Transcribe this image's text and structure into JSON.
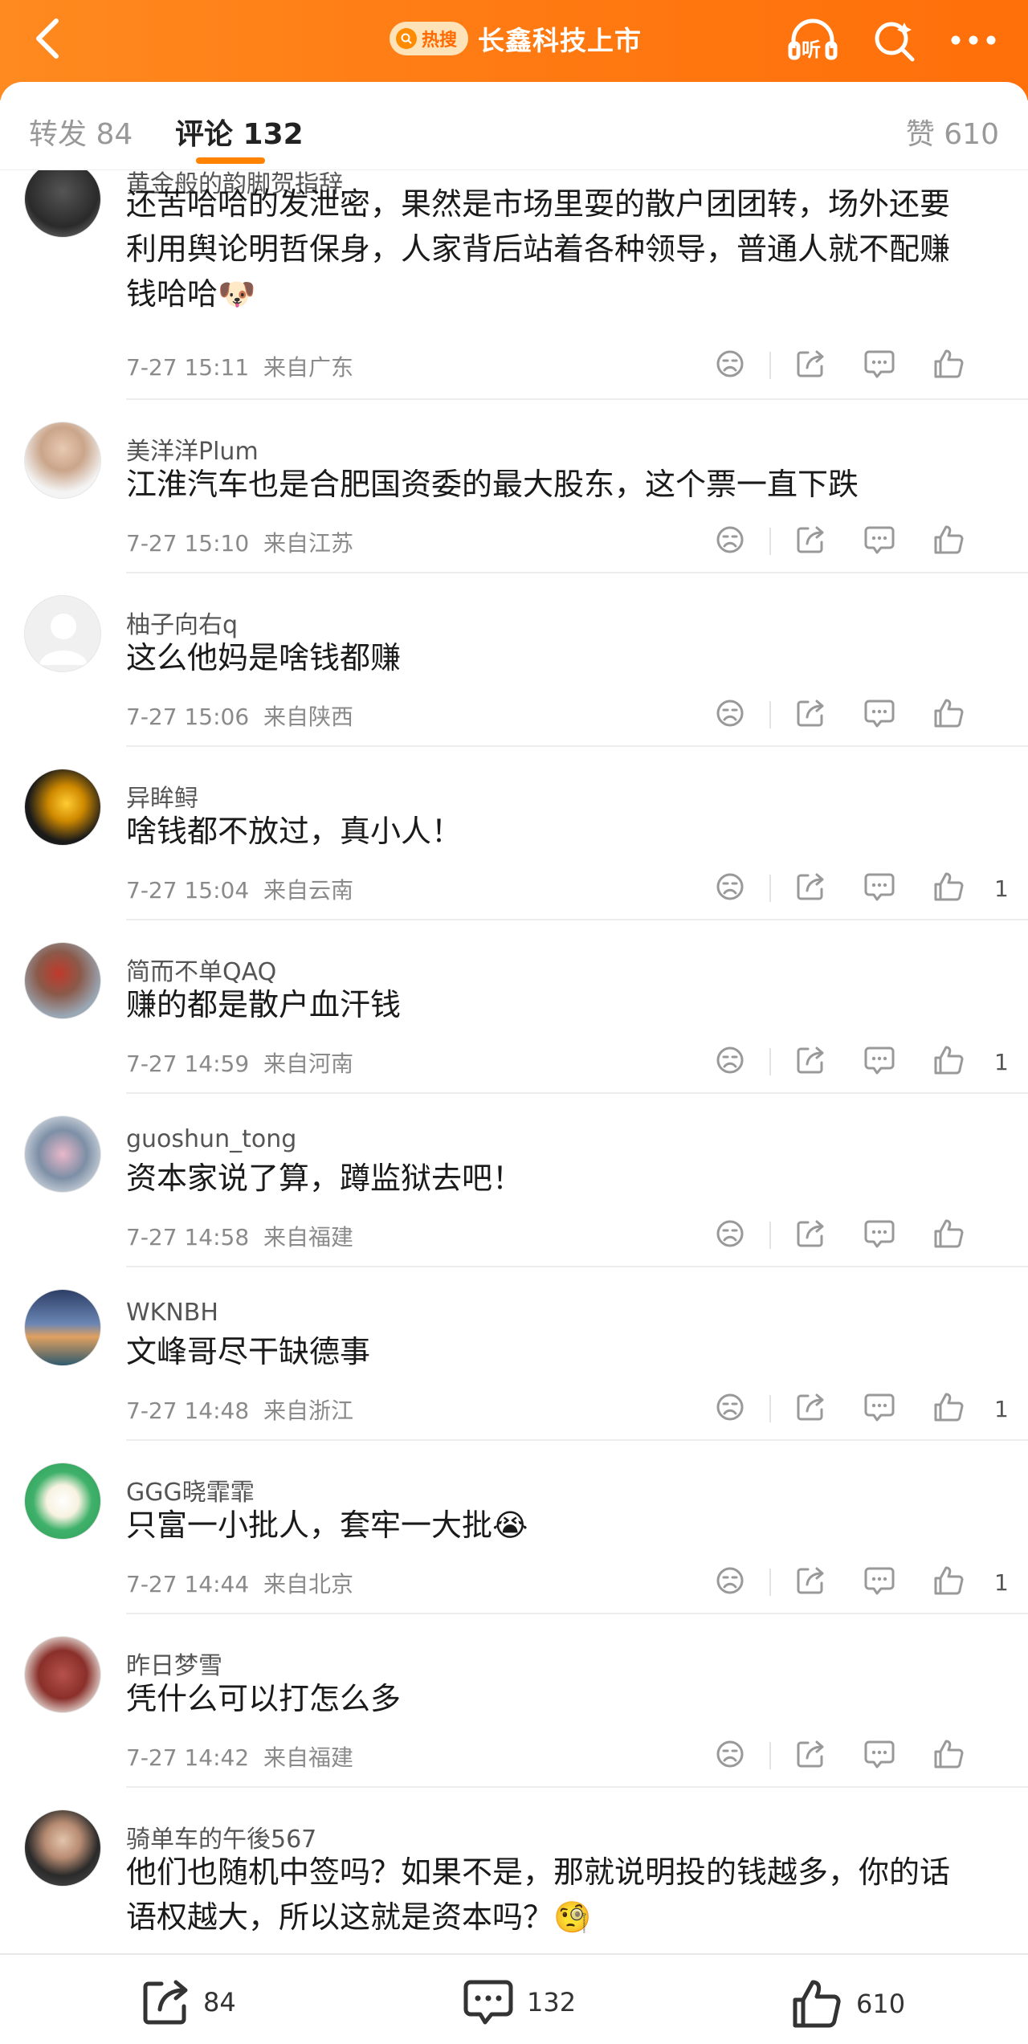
{
  "header": {
    "hot_badge": "热搜",
    "title": "长鑫科技上市",
    "listen_label": "听",
    "icons": [
      "back-icon",
      "listen-icon",
      "search-icon",
      "more-icon"
    ],
    "accent_color": "#ff7a12"
  },
  "tabs": {
    "repost": "转发 84",
    "comments": "评论 132",
    "likes": "赞 610"
  },
  "comments": [
    {
      "user": "黄金般的韵脚贺指辞",
      "text_lines": [
        "还苦哈哈的发泄密，果然是市场里耍的散户团团转，场外还要",
        "利用舆论明哲保身，人家背后站着各种领导，普通人就不配赚",
        "钱哈哈🐶"
      ],
      "time": "7-27 15:11",
      "location": "来自广东",
      "likes": ""
    },
    {
      "user": "美洋洋Plum",
      "text_lines": [
        "江淮汽车也是合肥国资委的最大股东，这个票一直下跌"
      ],
      "time": "7-27 15:10",
      "location": "来自江苏",
      "likes": ""
    },
    {
      "user": "柚子向右q",
      "text_lines": [
        "这么他妈是啥钱都赚"
      ],
      "time": "7-27 15:06",
      "location": "来自陕西",
      "likes": ""
    },
    {
      "user": "异眸鲟",
      "text_lines": [
        "啥钱都不放过，真小人！"
      ],
      "time": "7-27 15:04",
      "location": "来自云南",
      "likes": "1"
    },
    {
      "user": "简而不单QAQ",
      "text_lines": [
        "赚的都是散户血汗钱"
      ],
      "time": "7-27 14:59",
      "location": "来自河南",
      "likes": "1"
    },
    {
      "user": "guoshun_tong",
      "text_lines": [
        "资本家说了算，蹲监狱去吧！"
      ],
      "time": "7-27 14:58",
      "location": "来自福建",
      "likes": ""
    },
    {
      "user": "WKNBH",
      "text_lines": [
        "文峰哥尽干缺德事"
      ],
      "time": "7-27 14:48",
      "location": "来自浙江",
      "likes": "1"
    },
    {
      "user": "GGG晓霏霏",
      "text_lines": [
        "只富一小批人，套牢一大批😭"
      ],
      "time": "7-27 14:44",
      "location": "来自北京",
      "likes": "1"
    },
    {
      "user": "昨日梦雪",
      "text_lines": [
        "凭什么可以打怎么多"
      ],
      "time": "7-27 14:42",
      "location": "来自福建",
      "likes": ""
    },
    {
      "user": "骑单车的午後567",
      "text_lines": [
        "他们也随机中签吗？如果不是，那就说明投的钱越多，你的话",
        "语权越大，所以这就是资本吗？🧐"
      ],
      "time": "",
      "location": "",
      "likes": ""
    }
  ],
  "bottom_bar": {
    "repost_count": "84",
    "comment_count": "132",
    "like_count": "610"
  }
}
